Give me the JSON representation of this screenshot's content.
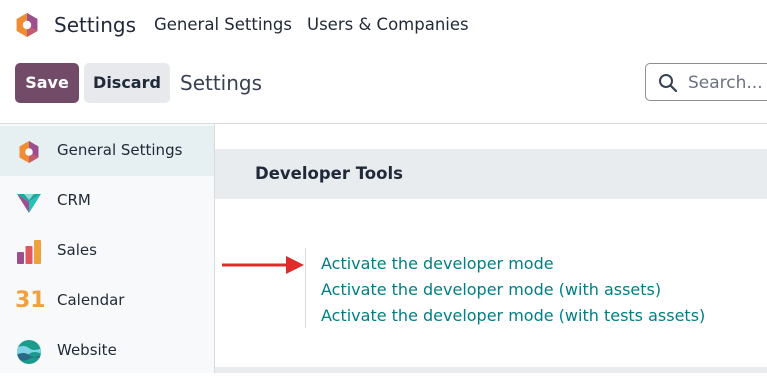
{
  "navbar": {
    "app_name": "Settings",
    "menu": [
      "General Settings",
      "Users & Companies"
    ]
  },
  "control_panel": {
    "save_label": "Save",
    "discard_label": "Discard",
    "breadcrumb": "Settings",
    "search_placeholder": "Search..."
  },
  "sidebar": {
    "items": [
      {
        "label": "General Settings",
        "icon": "settings-hexagon-icon",
        "active": true
      },
      {
        "label": "CRM",
        "icon": "crm-icon"
      },
      {
        "label": "Sales",
        "icon": "sales-chart-icon"
      },
      {
        "label": "Calendar",
        "icon": "calendar-31-icon",
        "icon_text": "31"
      },
      {
        "label": "Website",
        "icon": "website-globe-icon"
      }
    ]
  },
  "content": {
    "section_title": "Developer Tools",
    "links": [
      "Activate the developer mode",
      "Activate the developer mode (with assets)",
      "Activate the developer mode (with tests assets)"
    ]
  },
  "colors": {
    "primary": "#714b67",
    "link": "#017e84",
    "annotation_arrow": "#e02b2b"
  }
}
